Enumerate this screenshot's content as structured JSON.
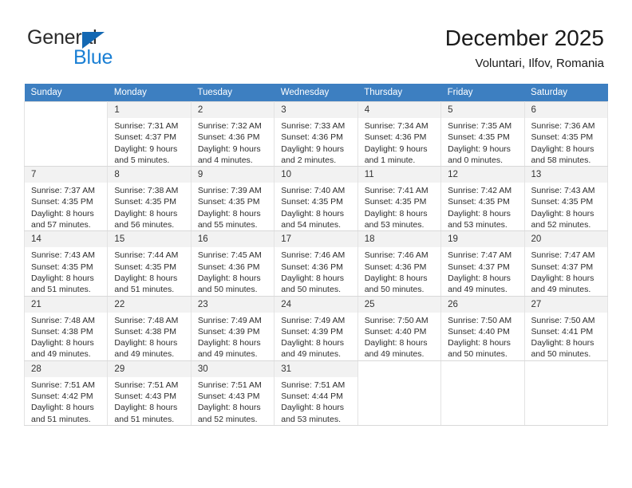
{
  "brand": {
    "name_top": "General",
    "name_bottom": "Blue",
    "accent_color": "#1368b3",
    "blue_text_color": "#1a7fd4"
  },
  "header": {
    "title": "December 2025",
    "subtitle": "Voluntari, Ilfov, Romania"
  },
  "calendar": {
    "header_color": "#3d7fc1",
    "weekday_headers": [
      "Sunday",
      "Monday",
      "Tuesday",
      "Wednesday",
      "Thursday",
      "Friday",
      "Saturday"
    ],
    "weeks": [
      [
        {
          "day": "",
          "sunrise": "",
          "sunset": "",
          "daylight_line1": "",
          "daylight_line2": ""
        },
        {
          "day": "1",
          "sunrise": "Sunrise: 7:31 AM",
          "sunset": "Sunset: 4:37 PM",
          "daylight_line1": "Daylight: 9 hours",
          "daylight_line2": "and 5 minutes."
        },
        {
          "day": "2",
          "sunrise": "Sunrise: 7:32 AM",
          "sunset": "Sunset: 4:36 PM",
          "daylight_line1": "Daylight: 9 hours",
          "daylight_line2": "and 4 minutes."
        },
        {
          "day": "3",
          "sunrise": "Sunrise: 7:33 AM",
          "sunset": "Sunset: 4:36 PM",
          "daylight_line1": "Daylight: 9 hours",
          "daylight_line2": "and 2 minutes."
        },
        {
          "day": "4",
          "sunrise": "Sunrise: 7:34 AM",
          "sunset": "Sunset: 4:36 PM",
          "daylight_line1": "Daylight: 9 hours",
          "daylight_line2": "and 1 minute."
        },
        {
          "day": "5",
          "sunrise": "Sunrise: 7:35 AM",
          "sunset": "Sunset: 4:35 PM",
          "daylight_line1": "Daylight: 9 hours",
          "daylight_line2": "and 0 minutes."
        },
        {
          "day": "6",
          "sunrise": "Sunrise: 7:36 AM",
          "sunset": "Sunset: 4:35 PM",
          "daylight_line1": "Daylight: 8 hours",
          "daylight_line2": "and 58 minutes."
        }
      ],
      [
        {
          "day": "7",
          "sunrise": "Sunrise: 7:37 AM",
          "sunset": "Sunset: 4:35 PM",
          "daylight_line1": "Daylight: 8 hours",
          "daylight_line2": "and 57 minutes."
        },
        {
          "day": "8",
          "sunrise": "Sunrise: 7:38 AM",
          "sunset": "Sunset: 4:35 PM",
          "daylight_line1": "Daylight: 8 hours",
          "daylight_line2": "and 56 minutes."
        },
        {
          "day": "9",
          "sunrise": "Sunrise: 7:39 AM",
          "sunset": "Sunset: 4:35 PM",
          "daylight_line1": "Daylight: 8 hours",
          "daylight_line2": "and 55 minutes."
        },
        {
          "day": "10",
          "sunrise": "Sunrise: 7:40 AM",
          "sunset": "Sunset: 4:35 PM",
          "daylight_line1": "Daylight: 8 hours",
          "daylight_line2": "and 54 minutes."
        },
        {
          "day": "11",
          "sunrise": "Sunrise: 7:41 AM",
          "sunset": "Sunset: 4:35 PM",
          "daylight_line1": "Daylight: 8 hours",
          "daylight_line2": "and 53 minutes."
        },
        {
          "day": "12",
          "sunrise": "Sunrise: 7:42 AM",
          "sunset": "Sunset: 4:35 PM",
          "daylight_line1": "Daylight: 8 hours",
          "daylight_line2": "and 53 minutes."
        },
        {
          "day": "13",
          "sunrise": "Sunrise: 7:43 AM",
          "sunset": "Sunset: 4:35 PM",
          "daylight_line1": "Daylight: 8 hours",
          "daylight_line2": "and 52 minutes."
        }
      ],
      [
        {
          "day": "14",
          "sunrise": "Sunrise: 7:43 AM",
          "sunset": "Sunset: 4:35 PM",
          "daylight_line1": "Daylight: 8 hours",
          "daylight_line2": "and 51 minutes."
        },
        {
          "day": "15",
          "sunrise": "Sunrise: 7:44 AM",
          "sunset": "Sunset: 4:35 PM",
          "daylight_line1": "Daylight: 8 hours",
          "daylight_line2": "and 51 minutes."
        },
        {
          "day": "16",
          "sunrise": "Sunrise: 7:45 AM",
          "sunset": "Sunset: 4:36 PM",
          "daylight_line1": "Daylight: 8 hours",
          "daylight_line2": "and 50 minutes."
        },
        {
          "day": "17",
          "sunrise": "Sunrise: 7:46 AM",
          "sunset": "Sunset: 4:36 PM",
          "daylight_line1": "Daylight: 8 hours",
          "daylight_line2": "and 50 minutes."
        },
        {
          "day": "18",
          "sunrise": "Sunrise: 7:46 AM",
          "sunset": "Sunset: 4:36 PM",
          "daylight_line1": "Daylight: 8 hours",
          "daylight_line2": "and 50 minutes."
        },
        {
          "day": "19",
          "sunrise": "Sunrise: 7:47 AM",
          "sunset": "Sunset: 4:37 PM",
          "daylight_line1": "Daylight: 8 hours",
          "daylight_line2": "and 49 minutes."
        },
        {
          "day": "20",
          "sunrise": "Sunrise: 7:47 AM",
          "sunset": "Sunset: 4:37 PM",
          "daylight_line1": "Daylight: 8 hours",
          "daylight_line2": "and 49 minutes."
        }
      ],
      [
        {
          "day": "21",
          "sunrise": "Sunrise: 7:48 AM",
          "sunset": "Sunset: 4:38 PM",
          "daylight_line1": "Daylight: 8 hours",
          "daylight_line2": "and 49 minutes."
        },
        {
          "day": "22",
          "sunrise": "Sunrise: 7:48 AM",
          "sunset": "Sunset: 4:38 PM",
          "daylight_line1": "Daylight: 8 hours",
          "daylight_line2": "and 49 minutes."
        },
        {
          "day": "23",
          "sunrise": "Sunrise: 7:49 AM",
          "sunset": "Sunset: 4:39 PM",
          "daylight_line1": "Daylight: 8 hours",
          "daylight_line2": "and 49 minutes."
        },
        {
          "day": "24",
          "sunrise": "Sunrise: 7:49 AM",
          "sunset": "Sunset: 4:39 PM",
          "daylight_line1": "Daylight: 8 hours",
          "daylight_line2": "and 49 minutes."
        },
        {
          "day": "25",
          "sunrise": "Sunrise: 7:50 AM",
          "sunset": "Sunset: 4:40 PM",
          "daylight_line1": "Daylight: 8 hours",
          "daylight_line2": "and 49 minutes."
        },
        {
          "day": "26",
          "sunrise": "Sunrise: 7:50 AM",
          "sunset": "Sunset: 4:40 PM",
          "daylight_line1": "Daylight: 8 hours",
          "daylight_line2": "and 50 minutes."
        },
        {
          "day": "27",
          "sunrise": "Sunrise: 7:50 AM",
          "sunset": "Sunset: 4:41 PM",
          "daylight_line1": "Daylight: 8 hours",
          "daylight_line2": "and 50 minutes."
        }
      ],
      [
        {
          "day": "28",
          "sunrise": "Sunrise: 7:51 AM",
          "sunset": "Sunset: 4:42 PM",
          "daylight_line1": "Daylight: 8 hours",
          "daylight_line2": "and 51 minutes."
        },
        {
          "day": "29",
          "sunrise": "Sunrise: 7:51 AM",
          "sunset": "Sunset: 4:43 PM",
          "daylight_line1": "Daylight: 8 hours",
          "daylight_line2": "and 51 minutes."
        },
        {
          "day": "30",
          "sunrise": "Sunrise: 7:51 AM",
          "sunset": "Sunset: 4:43 PM",
          "daylight_line1": "Daylight: 8 hours",
          "daylight_line2": "and 52 minutes."
        },
        {
          "day": "31",
          "sunrise": "Sunrise: 7:51 AM",
          "sunset": "Sunset: 4:44 PM",
          "daylight_line1": "Daylight: 8 hours",
          "daylight_line2": "and 53 minutes."
        },
        {
          "day": "",
          "sunrise": "",
          "sunset": "",
          "daylight_line1": "",
          "daylight_line2": ""
        },
        {
          "day": "",
          "sunrise": "",
          "sunset": "",
          "daylight_line1": "",
          "daylight_line2": ""
        },
        {
          "day": "",
          "sunrise": "",
          "sunset": "",
          "daylight_line1": "",
          "daylight_line2": ""
        }
      ]
    ]
  }
}
